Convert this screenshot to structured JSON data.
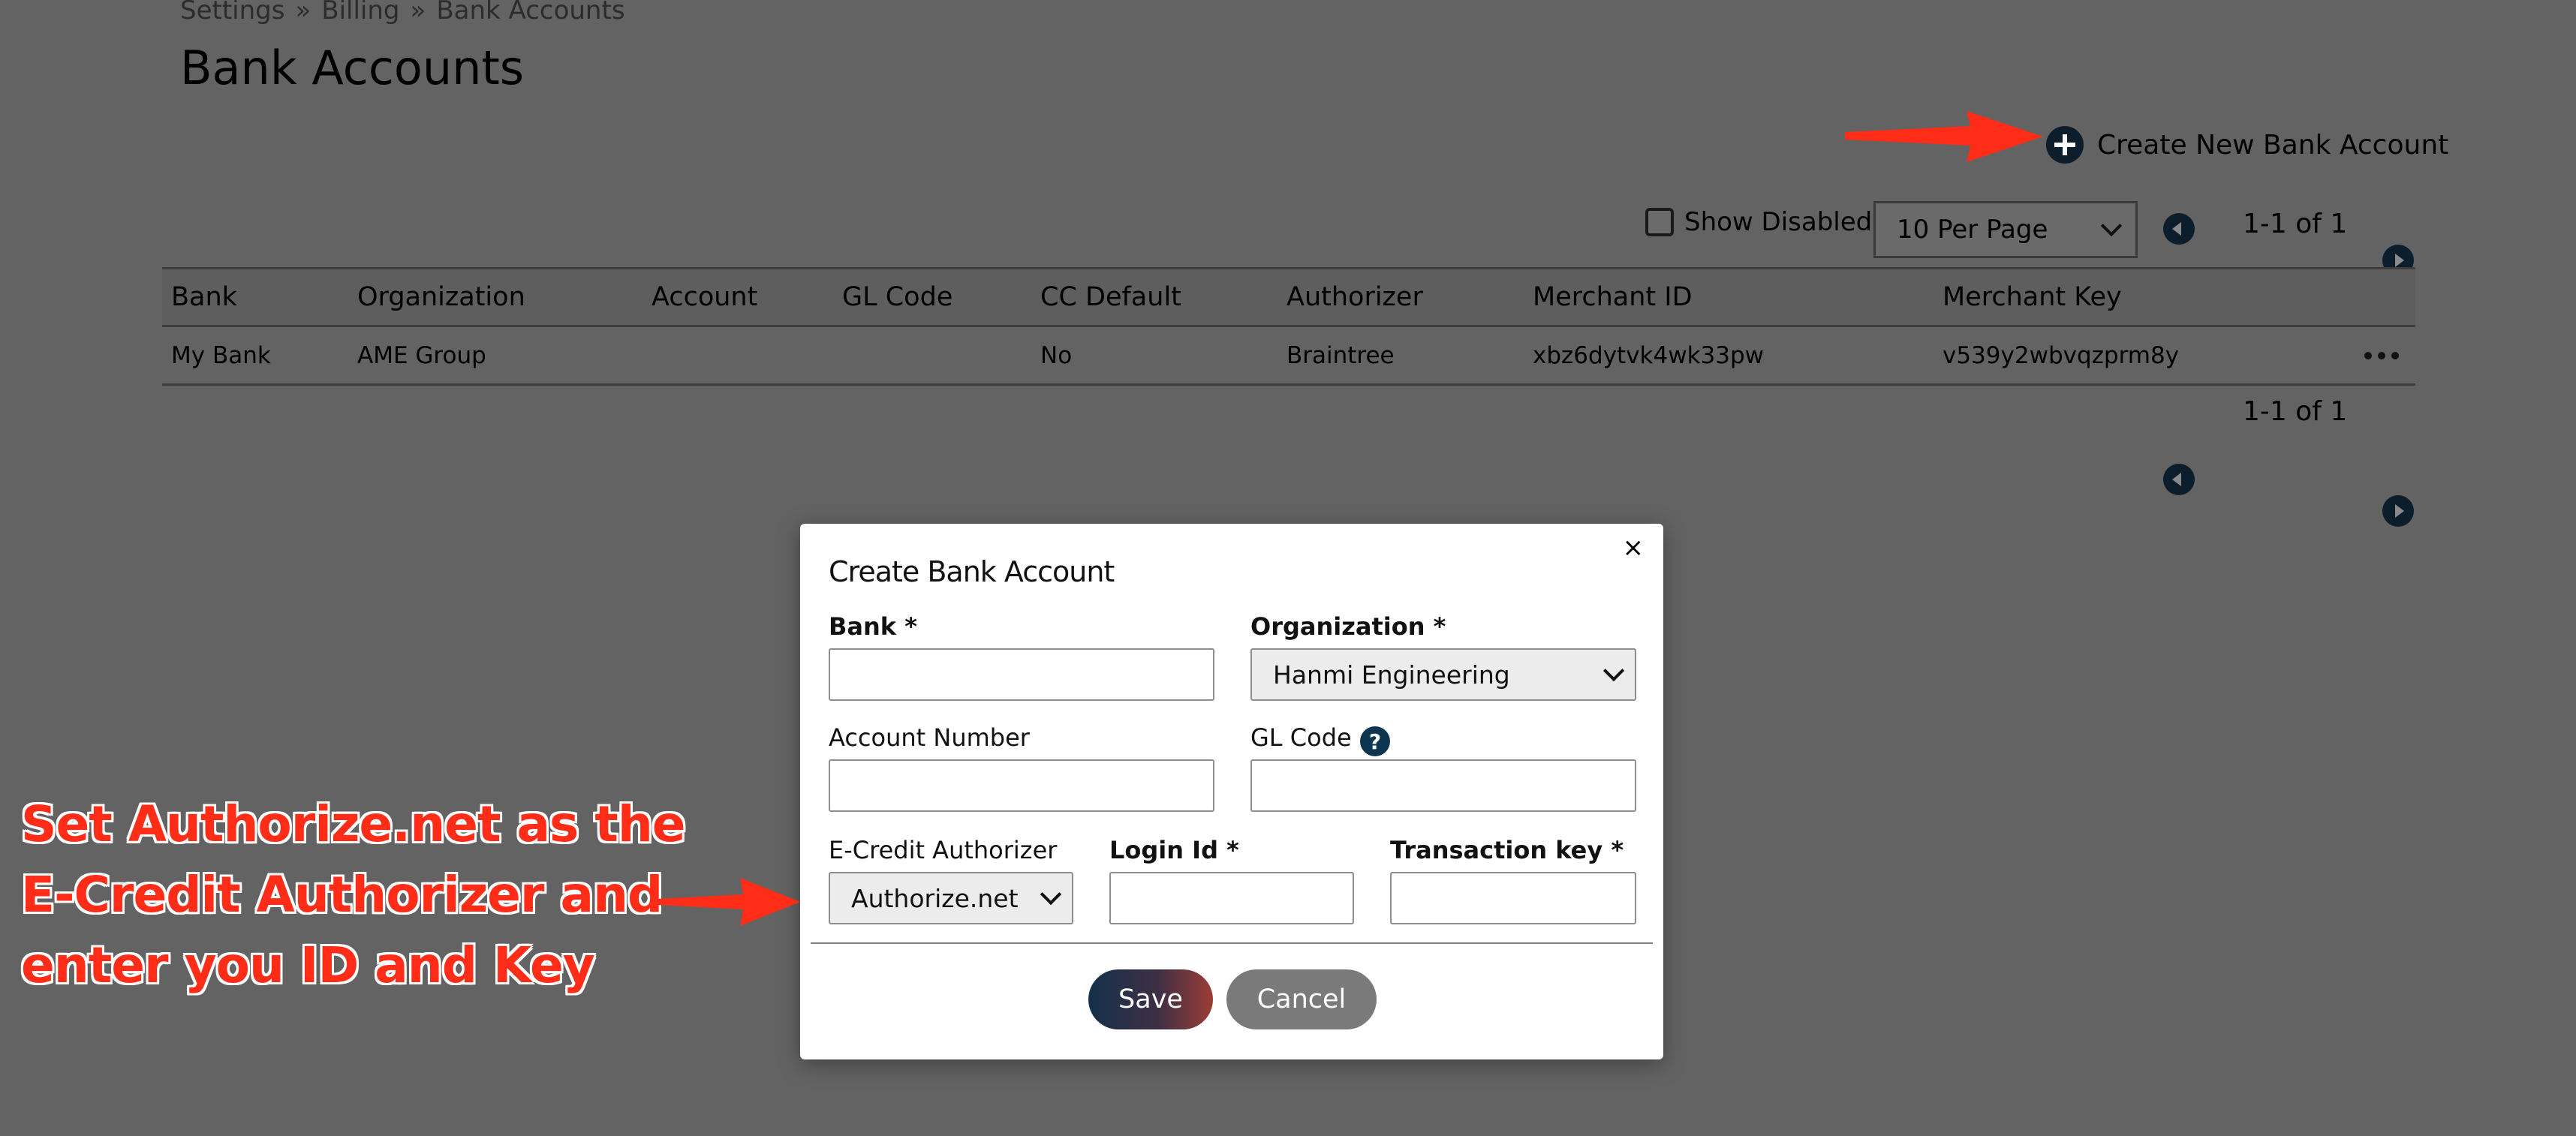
{
  "breadcrumb": [
    "Settings",
    "Billing",
    "Bank Accounts"
  ],
  "breadcrumb_separator": "»",
  "page_title": "Bank Accounts",
  "actions": {
    "create_label": "Create New Bank Account"
  },
  "toolbar": {
    "show_disabled_label": "Show Disabled",
    "per_page_value": "10 Per Page",
    "pagination_text": "1-1 of 1"
  },
  "table": {
    "headers": [
      "Bank",
      "Organization",
      "Account",
      "GL Code",
      "CC Default",
      "Authorizer",
      "Merchant ID",
      "Merchant Key"
    ],
    "rows": [
      {
        "bank": "My Bank",
        "organization": "AME Group",
        "account": "",
        "gl_code": "",
        "cc_default": "No",
        "authorizer": "Braintree",
        "merchant_id": "xbz6dytvk4wk33pw",
        "merchant_key": "v539y2wbvqzprm8y"
      }
    ]
  },
  "modal": {
    "title": "Create Bank Account",
    "close_label": "×",
    "bank_label": "Bank *",
    "organization_label": "Organization *",
    "organization_value": "Hanmi Engineering",
    "account_number_label": "Account Number",
    "gl_code_label": "GL Code",
    "help_glyph": "?",
    "authorizer_label": "E-Credit Authorizer",
    "authorizer_value": "Authorize.net",
    "login_id_label": "Login Id *",
    "transaction_key_label": "Transaction key *",
    "save_label": "Save",
    "cancel_label": "Cancel"
  },
  "annotation": {
    "lines": [
      "Set Authorize.net as the",
      "E-Credit Authorizer and",
      "enter you ID and Key"
    ],
    "color": "#ff2d17"
  },
  "colors": {
    "overlay_background": "#636363",
    "accent_dark": "#0c1e2b",
    "help_icon": "#0d3550"
  }
}
